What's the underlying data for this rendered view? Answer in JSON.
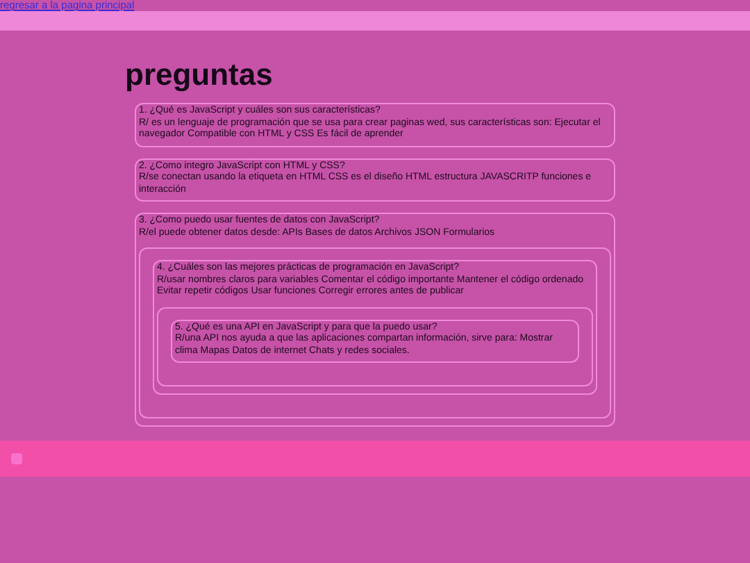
{
  "back_link": "regresar a la pagina principal",
  "title": "preguntas",
  "questions": [
    {
      "question": "1. ¿Qué es JavaScript y cuáles son sus características?",
      "answer": "R/ es un lenguaje de programación que se usa para crear paginas wed, sus características son: Ejecutar el navegador Compatible con HTML y CSS Es fácil de aprender"
    },
    {
      "question": "2. ¿Como integro JavaScript con HTML y CSS?",
      "answer": "R/se conectan usando la etiqueta en HTML CSS es el diseño HTML estructura JAVASCRITP funciones e interacción"
    },
    {
      "question": "3. ¿Como puedo usar fuentes de datos con JavaScript?",
      "answer": "R/el puede obtener datos desde: APIs Bases de datos Archivos JSON Formularios",
      "children": [
        {
          "question": "4. ¿Cuáles son las mejores prácticas de programación en JavaScript?",
          "answer": "R/usar nombres claros para variables Comentar el código importante Mantener el código ordenado Evitar repetir códigos Usar funciones Corregir errores antes de publicar",
          "children": [
            {
              "question": "5. ¿Qué es una API en JavaScript y para que la puedo usar?",
              "answer": "R/una API nos ayuda a que las aplicaciones compartan información, sirve para: Mostrar clima Mapas Datos de internet Chats y redes sociales."
            }
          ]
        }
      ]
    }
  ]
}
